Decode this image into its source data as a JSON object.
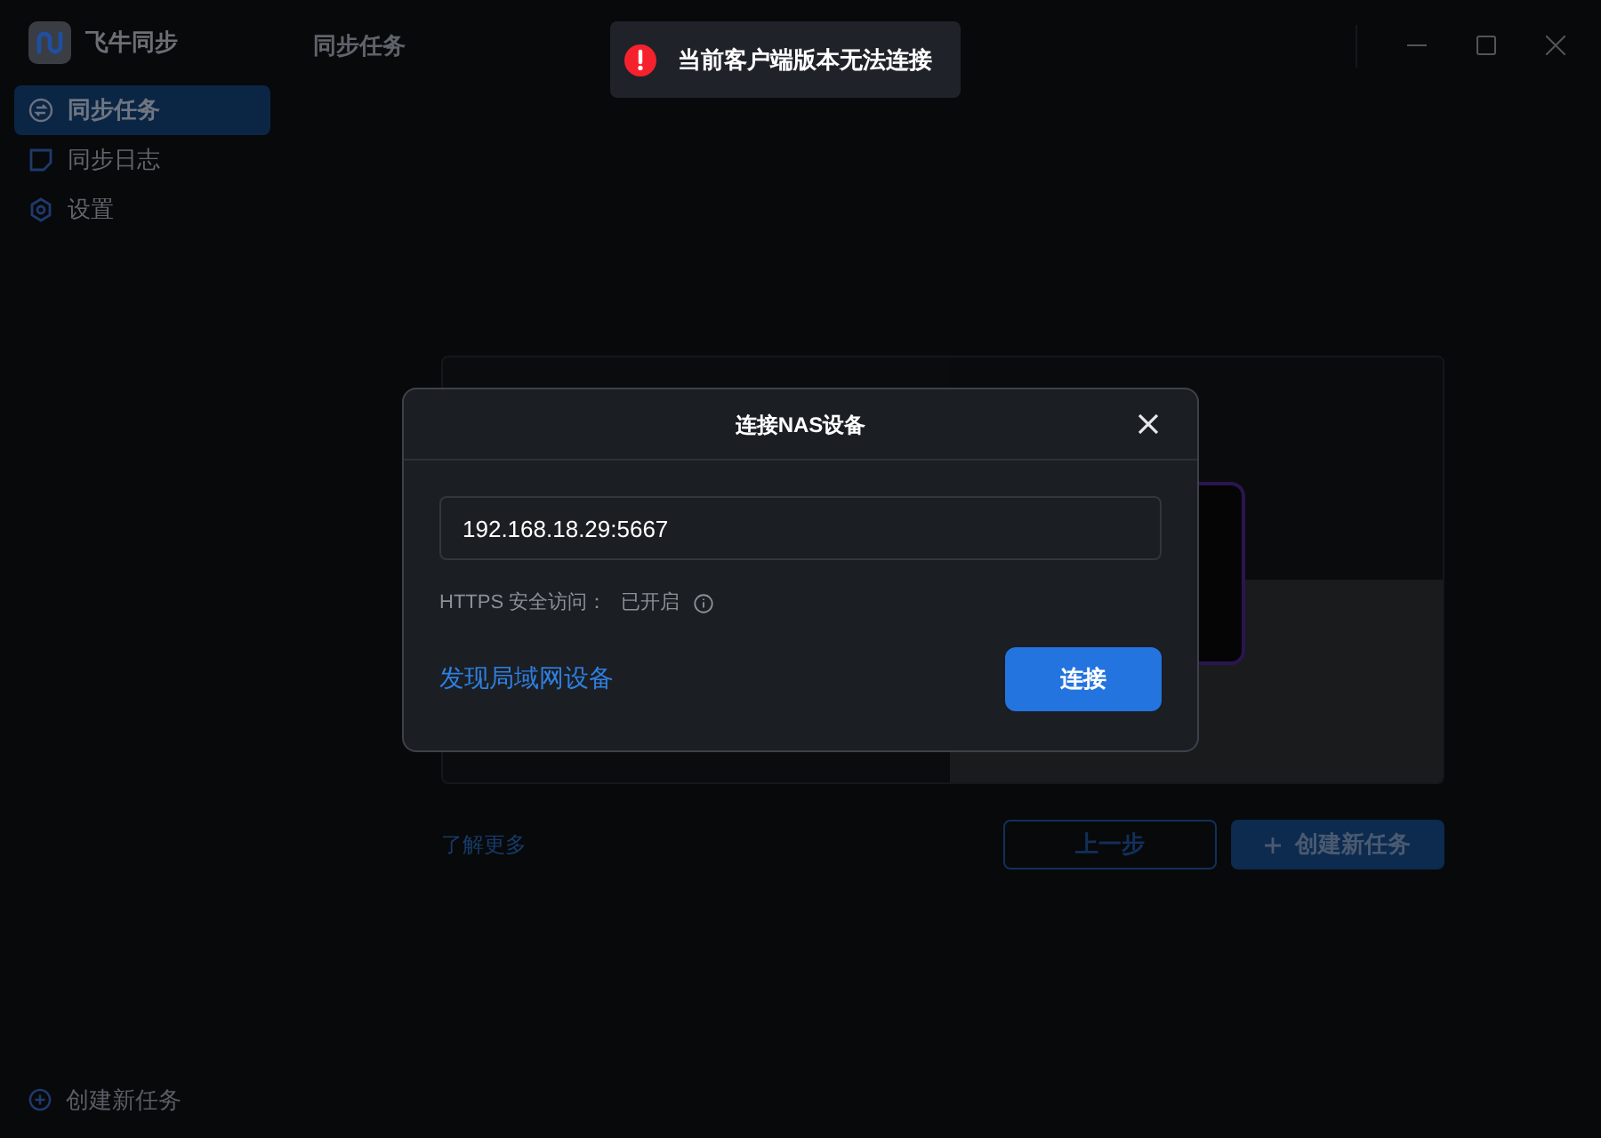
{
  "app": {
    "name": "飞牛同步"
  },
  "header": {
    "title": "同步任务"
  },
  "sidebar": {
    "items": [
      {
        "label": "同步任务",
        "kind": "sync",
        "selected": true
      },
      {
        "label": "同步日志",
        "kind": "note",
        "selected": false
      },
      {
        "label": "设置",
        "kind": "gear",
        "selected": false
      }
    ],
    "footer_button": "创建新任务"
  },
  "toast": {
    "text": "当前客户端版本无法连接"
  },
  "background_page": {
    "learn_more": "了解更多",
    "prev_button": "上一步",
    "create_button": "创建新任务"
  },
  "dialog": {
    "title": "连接NAS设备",
    "address": "192.168.18.29:5667",
    "https_label": "HTTPS 安全访问：",
    "https_value": "已开启",
    "discover_link": "发现局域网设备",
    "connect_button": "连接"
  }
}
